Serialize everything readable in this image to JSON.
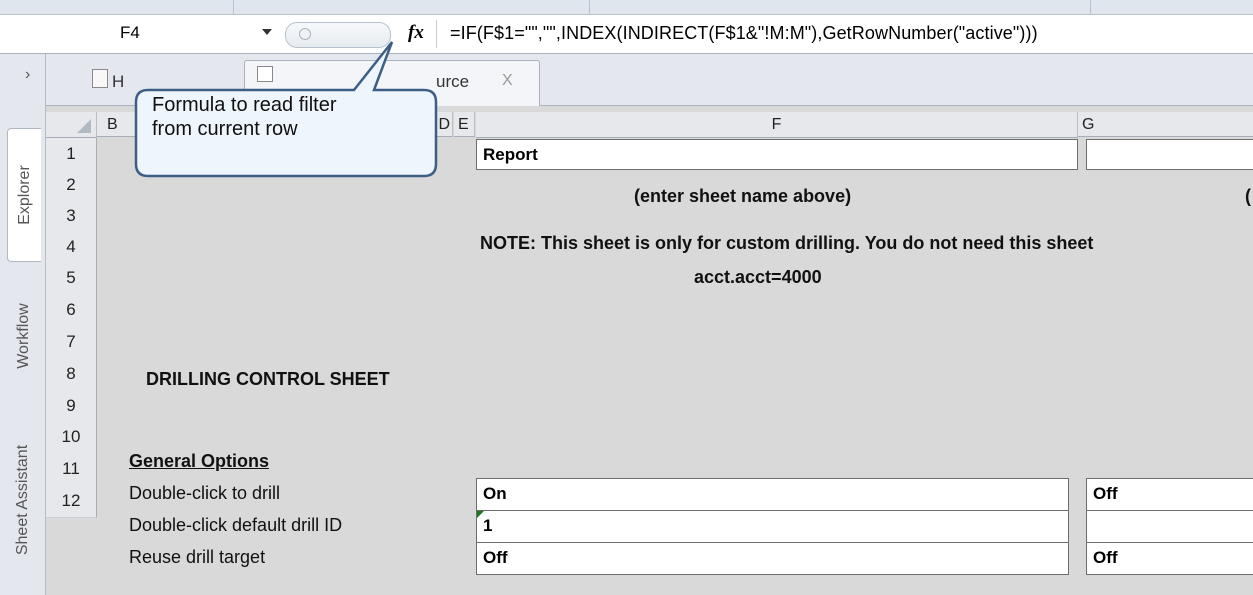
{
  "formula_bar": {
    "name_box": "F4",
    "fx_label": "fx",
    "formula": "=IF(F$1=\"\",\"\",INDEX(INDIRECT(F$1&\"!M:M\"),GetRowNumber(\"active\")))"
  },
  "task_pane": {
    "tabs": [
      "Explorer",
      "Workflow",
      "Sheet Assistant"
    ]
  },
  "sheet_tabs": [
    {
      "label": "H",
      "active": false
    },
    {
      "label": "urce",
      "active": true,
      "close": "X"
    }
  ],
  "callout": {
    "line1": "Formula to read filter",
    "line2": "from current row"
  },
  "columns": [
    "B",
    "D",
    "E",
    "F",
    "G"
  ],
  "rows": [
    "1",
    "2",
    "3",
    "4",
    "5",
    "6",
    "7",
    "8",
    "9",
    "10",
    "11",
    "12"
  ],
  "cells": {
    "F1": "Report",
    "F2": "(enter sheet name above)",
    "G2": "(",
    "F3": "NOTE: This sheet is only for custom drilling. You do not need this sheet",
    "F4": "acct.acct=4000",
    "B7": "DRILLING CONTROL SHEET",
    "B9": "General Options",
    "B10": "Double-click to drill",
    "F10": "On",
    "G10": "Off",
    "B11": "Double-click default drill ID",
    "F11": "1",
    "G11": "",
    "B12": "Reuse drill target",
    "F12": "Off",
    "G12": "Off"
  },
  "colors": {
    "grid_background": "#d9d9d9",
    "header_background": "#e6e8eb",
    "callout_fill": "#eef5fc",
    "callout_border": "#3d5f85",
    "comment_indicator": "#1a7a1a"
  }
}
